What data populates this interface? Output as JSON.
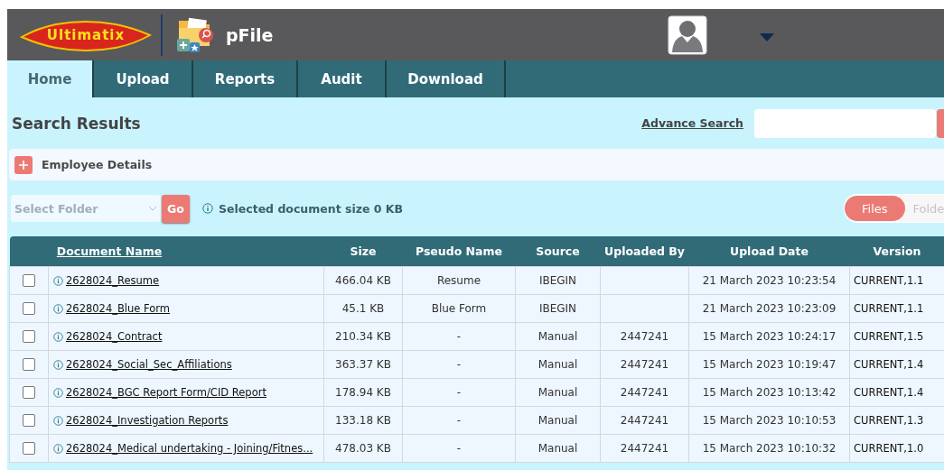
{
  "header": {
    "logo": "Ultimatix",
    "app_title": "pFile"
  },
  "tabs": [
    {
      "label": "Home",
      "selected": true
    },
    {
      "label": "Upload",
      "selected": false
    },
    {
      "label": "Reports",
      "selected": false
    },
    {
      "label": "Audit",
      "selected": false
    },
    {
      "label": "Download",
      "selected": false
    }
  ],
  "page_title": "Search Results",
  "advance_search": "Advance Search",
  "employee_details": "Employee Details",
  "folder_select": {
    "placeholder": "Select Folder"
  },
  "go_button": "Go",
  "selected_size": "Selected document size 0 KB",
  "view_toggle": [
    {
      "label": "Files",
      "selected": true
    },
    {
      "label": "Folde",
      "selected": false
    }
  ],
  "table": {
    "columns": [
      "Document Name",
      "Size",
      "Pseudo Name",
      "Source",
      "Uploaded By",
      "Upload Date",
      "Version"
    ],
    "rows": [
      {
        "checked": false,
        "name": "2628024_Resume",
        "size": "466.04 KB",
        "pseudo": "Resume",
        "source": "IBEGIN",
        "uploaded_by": "",
        "date": "21 March 2023 10:23:54",
        "version": "CURRENT,1.1"
      },
      {
        "checked": false,
        "name": "2628024_Blue Form",
        "size": "45.1 KB",
        "pseudo": "Blue Form",
        "source": "IBEGIN",
        "uploaded_by": "",
        "date": "21 March 2023 10:23:09",
        "version": "CURRENT,1.1"
      },
      {
        "checked": false,
        "name": "2628024_Contract",
        "size": "210.34 KB",
        "pseudo": "-",
        "source": "Manual",
        "uploaded_by": "2447241",
        "date": "15 March 2023 10:24:17",
        "version": "CURRENT,1.5"
      },
      {
        "checked": false,
        "name": "2628024_Social_Sec_Affiliations",
        "size": "363.37 KB",
        "pseudo": "-",
        "source": "Manual",
        "uploaded_by": "2447241",
        "date": "15 March 2023 10:19:47",
        "version": "CURRENT,1.4"
      },
      {
        "checked": false,
        "name": "2628024_BGC Report Form/CID Report",
        "size": "178.94 KB",
        "pseudo": "-",
        "source": "Manual",
        "uploaded_by": "2447241",
        "date": "15 March 2023 10:13:42",
        "version": "CURRENT,1.4"
      },
      {
        "checked": false,
        "name": "2628024_Investigation Reports",
        "size": "133.18 KB",
        "pseudo": "-",
        "source": "Manual",
        "uploaded_by": "2447241",
        "date": "15 March 2023 10:10:53",
        "version": "CURRENT,1.3"
      },
      {
        "checked": false,
        "name": "2628024_Medical undertaking - Joining/Fitnes...",
        "size": "478.03 KB",
        "pseudo": "-",
        "source": "Manual",
        "uploaded_by": "2447241",
        "date": "15 March 2023 10:10:32",
        "version": "CURRENT,1.0"
      }
    ]
  }
}
